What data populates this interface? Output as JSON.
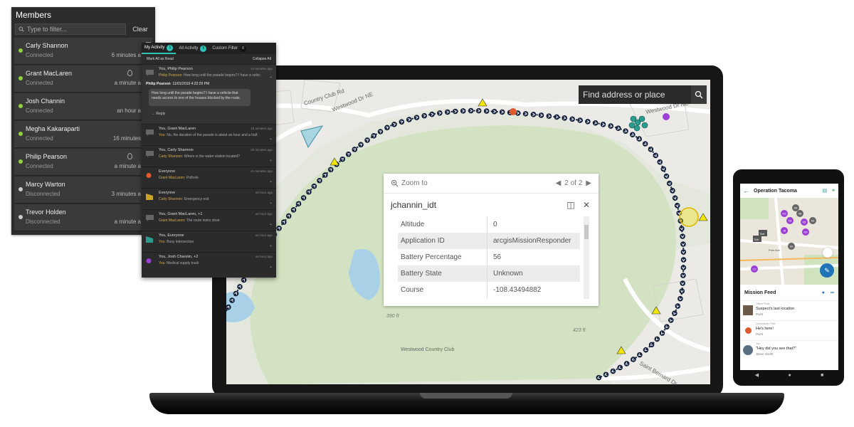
{
  "members_panel": {
    "title": "Members",
    "filter_placeholder": "Type to filter...",
    "clear_label": "Clear",
    "members": [
      {
        "name": "Carly Shannon",
        "status": "Connected",
        "time": "6 minutes a",
        "color": "#8fd13f"
      },
      {
        "name": "Grant MacLaren",
        "status": "Connected",
        "time": "a minute a",
        "color": "#8fd13f"
      },
      {
        "name": "Josh Channin",
        "status": "Connected",
        "time": "an hour a",
        "color": "#8fd13f"
      },
      {
        "name": "Megha Kakaraparti",
        "status": "Connected",
        "time": "16 minutes",
        "color": "#8fd13f"
      },
      {
        "name": "Philip Pearson",
        "status": "Connected",
        "time": "a minute a",
        "color": "#8fd13f"
      },
      {
        "name": "Marcy Warton",
        "status": "Disconnected",
        "time": "3 minutes a",
        "color": "#cccccc"
      },
      {
        "name": "Trevor Holden",
        "status": "Disconnected",
        "time": "a minute a",
        "color": "#cccccc"
      }
    ]
  },
  "activity_panel": {
    "tabs": [
      {
        "label": "My Activity",
        "count": "1"
      },
      {
        "label": "All Activity",
        "count": "5"
      },
      {
        "label": "Custom Filter",
        "count": "0"
      }
    ],
    "mark_all_read": "Mark All as Read",
    "collapse_all": "Collapse All",
    "open_item": {
      "who": "You, Philip Pearson",
      "time": "14 minutes ago",
      "sender": "Philip Pearson",
      "preview": "How long until the parade begins? I have a vehic",
      "bubble_header": "Philip Pearson",
      "bubble_time": "11/01/2019 4:22:29 PM",
      "bubble_text": "How long until the parade begins? I have a vehicle that needs access to one of the houses blocked by the route.",
      "reply_label": "Reply"
    },
    "items": [
      {
        "who": "You, Grant MacLaren",
        "time": "18 minutes ago",
        "sender": "You",
        "msg": "No, the duration of the parade is about an hour and a half."
      },
      {
        "who": "You, Carly Shannon",
        "time": "20 minutes ago",
        "sender": "Carly Shannon",
        "msg": "Where is the water station located?"
      },
      {
        "who": "Everyone",
        "time": "41 minutes ago",
        "sender": "Grant MacLaren",
        "msg": "Pothole"
      },
      {
        "who": "Everyone",
        "time": "an hour ago",
        "sender": "Carly Shannon",
        "msg": "Emergency exit"
      },
      {
        "who": "You, Grant MacLaren, +1",
        "time": "an hour ago",
        "sender": "Grant MacLaren",
        "msg": "The route looks clear"
      },
      {
        "who": "You, Everyone",
        "time": "an hour ago",
        "sender": "You",
        "msg": "Busy intersection"
      },
      {
        "who": "You, Josh Channin, +2",
        "time": "an hour ago",
        "sender": "You",
        "msg": "Medical supply truck"
      }
    ]
  },
  "map": {
    "search_placeholder": "Find address or place",
    "street_labels": [
      "Country Club Rd",
      "Westwood Dr NE",
      "Westwood Dr NE",
      "Saint Bernard Dr",
      "Westwood Country Club"
    ],
    "elevations": [
      "390 ft",
      "423 ft"
    ]
  },
  "popup": {
    "zoom_to": "Zoom to",
    "pager": "2 of 2",
    "title": "jchannin_idt",
    "attributes": [
      {
        "key": "Altitude",
        "value": "0"
      },
      {
        "key": "Application ID",
        "value": "arcgisMissionResponder"
      },
      {
        "key": "Battery Percentage",
        "value": "56"
      },
      {
        "key": "Battery State",
        "value": "Unknown"
      },
      {
        "key": "Course",
        "value": "-108.43494882"
      }
    ]
  },
  "phone": {
    "title": "Operation Tacoma",
    "feed_title": "Mission Feed",
    "map_labels": [
      "TAK",
      "TAK",
      "Park Ave"
    ],
    "feed": [
      {
        "label": "Officer Rose",
        "title": "Suspect's last location",
        "type": "Point"
      },
      {
        "label": "Commander Pete",
        "title": "He's here!",
        "type": "Point"
      },
      {
        "label": "You",
        "title": "\"Hey did you see that?\"",
        "type": "Steve Smith"
      }
    ],
    "avatars": [
      "GG",
      "SN",
      "AB",
      "KD",
      "CB",
      "JB",
      "RS",
      "AS",
      "SS",
      "CC"
    ]
  },
  "colors": {
    "accent_teal": "#2ec4b6",
    "connected_green": "#8fd13f",
    "route_navy": "#14213d",
    "marker_yellow": "#f2e600",
    "marker_orange": "#e05a2b",
    "avatar_purple": "#9c3fd6",
    "phone_blue": "#1f73b7"
  }
}
